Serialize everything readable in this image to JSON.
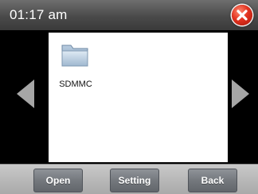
{
  "titlebar": {
    "time": "01:17 am",
    "close_icon": "close-icon"
  },
  "navigation": {
    "left_icon": "left-arrow-icon",
    "right_icon": "right-arrow-icon"
  },
  "files": [
    {
      "name": "SDMMC",
      "icon": "folder-icon"
    }
  ],
  "toolbar": {
    "open_label": "Open",
    "setting_label": "Setting",
    "back_label": "Back"
  },
  "colors": {
    "close_button": "#e2321f",
    "titlebar": "#4a4a4a",
    "toolbar": "#b8b8b8",
    "button": "#74787d"
  }
}
